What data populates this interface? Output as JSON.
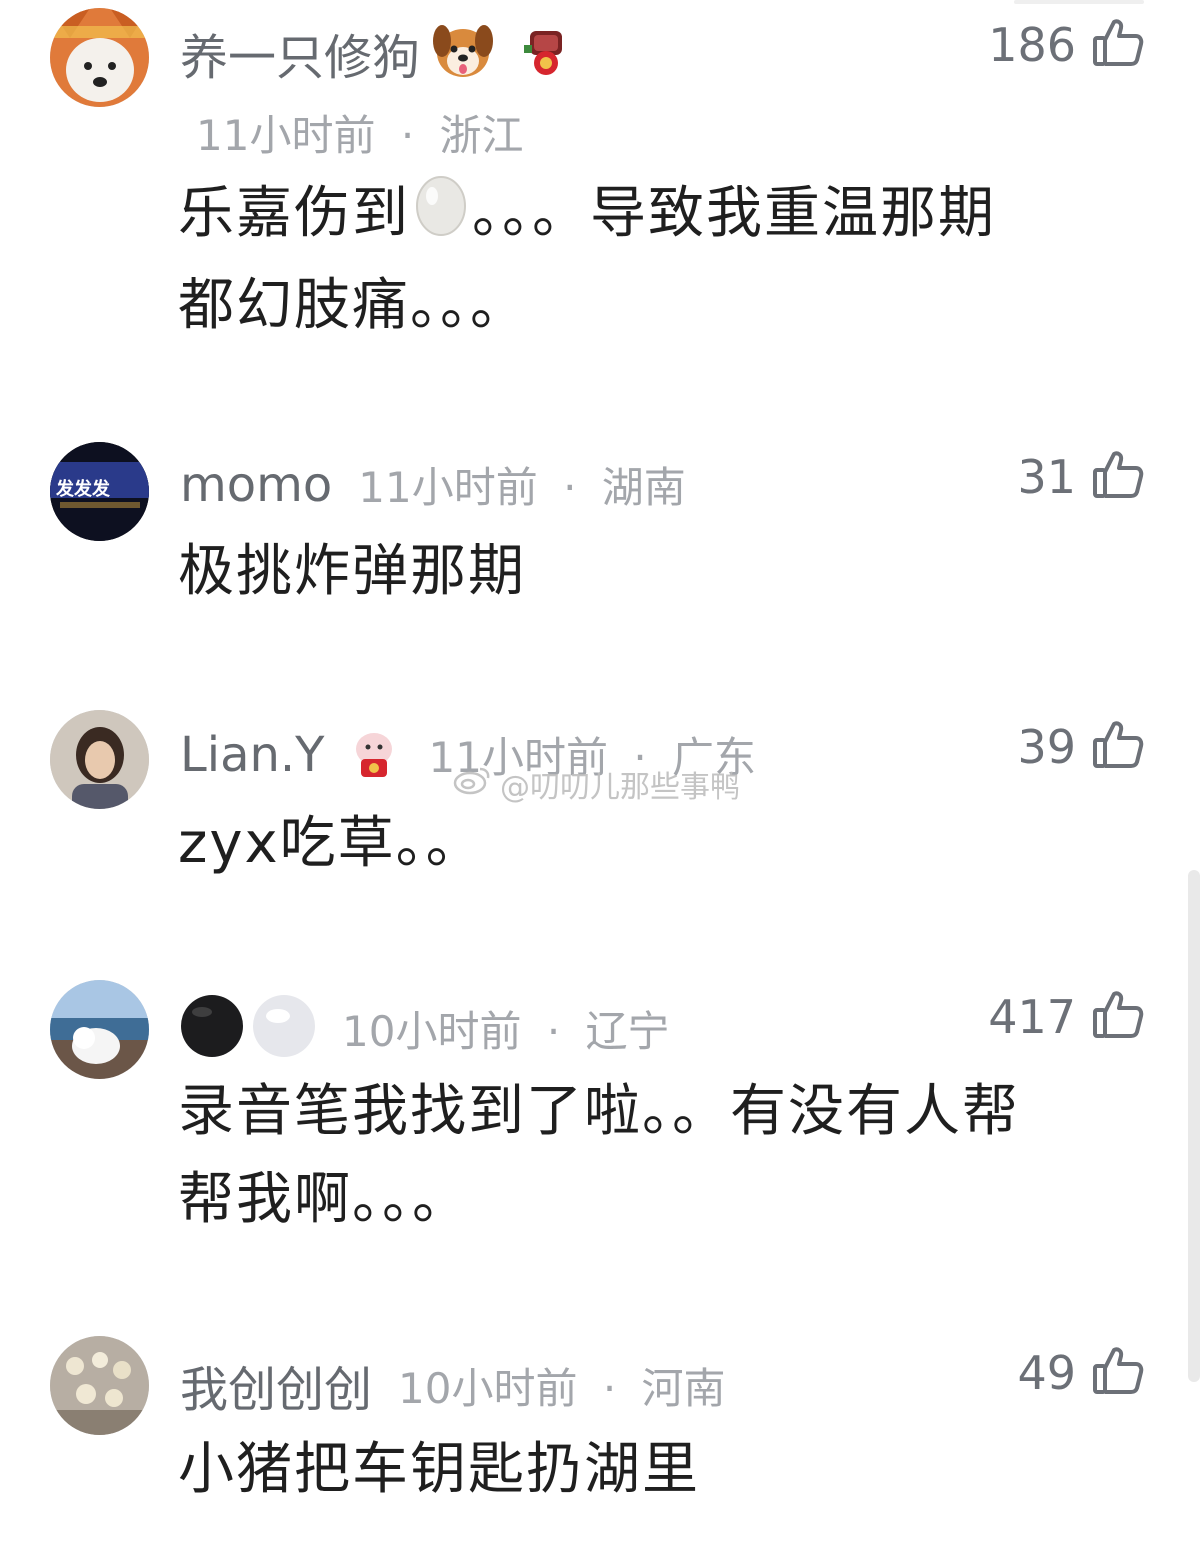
{
  "comments": [
    {
      "username": "养一只修狗",
      "time": "11小时前",
      "location": "浙江",
      "likes": "186",
      "text_line1": "乐嘉伤到",
      "text_line1b": "。。。导致我重温那期",
      "text_line2": "都幻肢痛。。。"
    },
    {
      "username": "momo",
      "time": "11小时前",
      "location": "湖南",
      "likes": "31",
      "text": "极挑炸弹那期",
      "avatar_text": "发发发"
    },
    {
      "username": "Lian.Y",
      "time": "11小时前",
      "location": "广东",
      "likes": "39",
      "text": "zyx吃草。。"
    },
    {
      "username": "",
      "time": "10小时前",
      "location": "辽宁",
      "likes": "417",
      "text_line1": "录音笔我找到了啦。。有没有人帮",
      "text_line2": "帮我啊。。。"
    },
    {
      "username": "我创创创",
      "time": "10小时前",
      "location": "河南",
      "likes": "49",
      "text": "小猪把车钥匙扔湖里"
    }
  ],
  "separator": "·",
  "watermark": "@叨叨儿那些事鸭",
  "icons": {
    "like": "thumbs-up-outline-icon",
    "dog_emoji": "dog-face-icon",
    "egg_emoji": "egg-icon"
  },
  "colors": {
    "username": "#666a70",
    "meta": "#a3a6ab",
    "body": "#1f1f1f"
  }
}
